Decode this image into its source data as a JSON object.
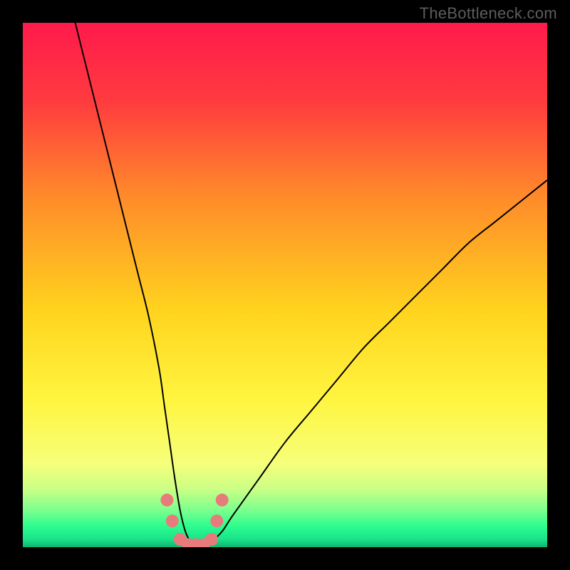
{
  "watermark": {
    "text": "TheBottleneck.com"
  },
  "chart_data": {
    "type": "line",
    "title": "",
    "xlabel": "",
    "ylabel": "",
    "xlim": [
      0,
      100
    ],
    "ylim": [
      0,
      100
    ],
    "grid": false,
    "legend": false,
    "background_gradient_stops": [
      {
        "offset": 0.0,
        "color": "#ff1a4b"
      },
      {
        "offset": 0.15,
        "color": "#ff3b3f"
      },
      {
        "offset": 0.33,
        "color": "#ff8a2a"
      },
      {
        "offset": 0.55,
        "color": "#ffd41e"
      },
      {
        "offset": 0.72,
        "color": "#fff540"
      },
      {
        "offset": 0.84,
        "color": "#f6ff7a"
      },
      {
        "offset": 0.89,
        "color": "#c9ff86"
      },
      {
        "offset": 0.93,
        "color": "#7aff8e"
      },
      {
        "offset": 0.96,
        "color": "#2dfc8e"
      },
      {
        "offset": 0.985,
        "color": "#19e38a"
      },
      {
        "offset": 1.0,
        "color": "#0fb56e"
      }
    ],
    "series": [
      {
        "name": "bottleneck-curve",
        "color": "#000000",
        "stroke_width": 2,
        "x": [
          10,
          12,
          14,
          16,
          18,
          20,
          22,
          24,
          26,
          27,
          28,
          29,
          30,
          31,
          32,
          33,
          34,
          35,
          36,
          38,
          40,
          45,
          50,
          55,
          60,
          65,
          70,
          75,
          80,
          85,
          90,
          95,
          100
        ],
        "y": [
          100,
          92,
          84,
          76,
          68,
          60,
          52,
          44,
          34,
          27,
          20,
          13,
          7,
          3,
          1,
          0,
          0,
          0,
          1,
          3,
          6,
          13,
          20,
          26,
          32,
          38,
          43,
          48,
          53,
          58,
          62,
          66,
          70
        ]
      },
      {
        "name": "bottleneck-marker-band",
        "color": "#e77b7b",
        "type": "scatter",
        "marker_radius": 9,
        "x": [
          27.5,
          28.5,
          30.0,
          31.5,
          33.0,
          34.5,
          36.0,
          37.0,
          38.0
        ],
        "y": [
          9.0,
          5.0,
          1.5,
          0.5,
          0.5,
          0.5,
          1.5,
          5.0,
          9.0
        ]
      }
    ],
    "notes": "Values estimated from pixel positions; plot has no visible axes or tick labels."
  }
}
